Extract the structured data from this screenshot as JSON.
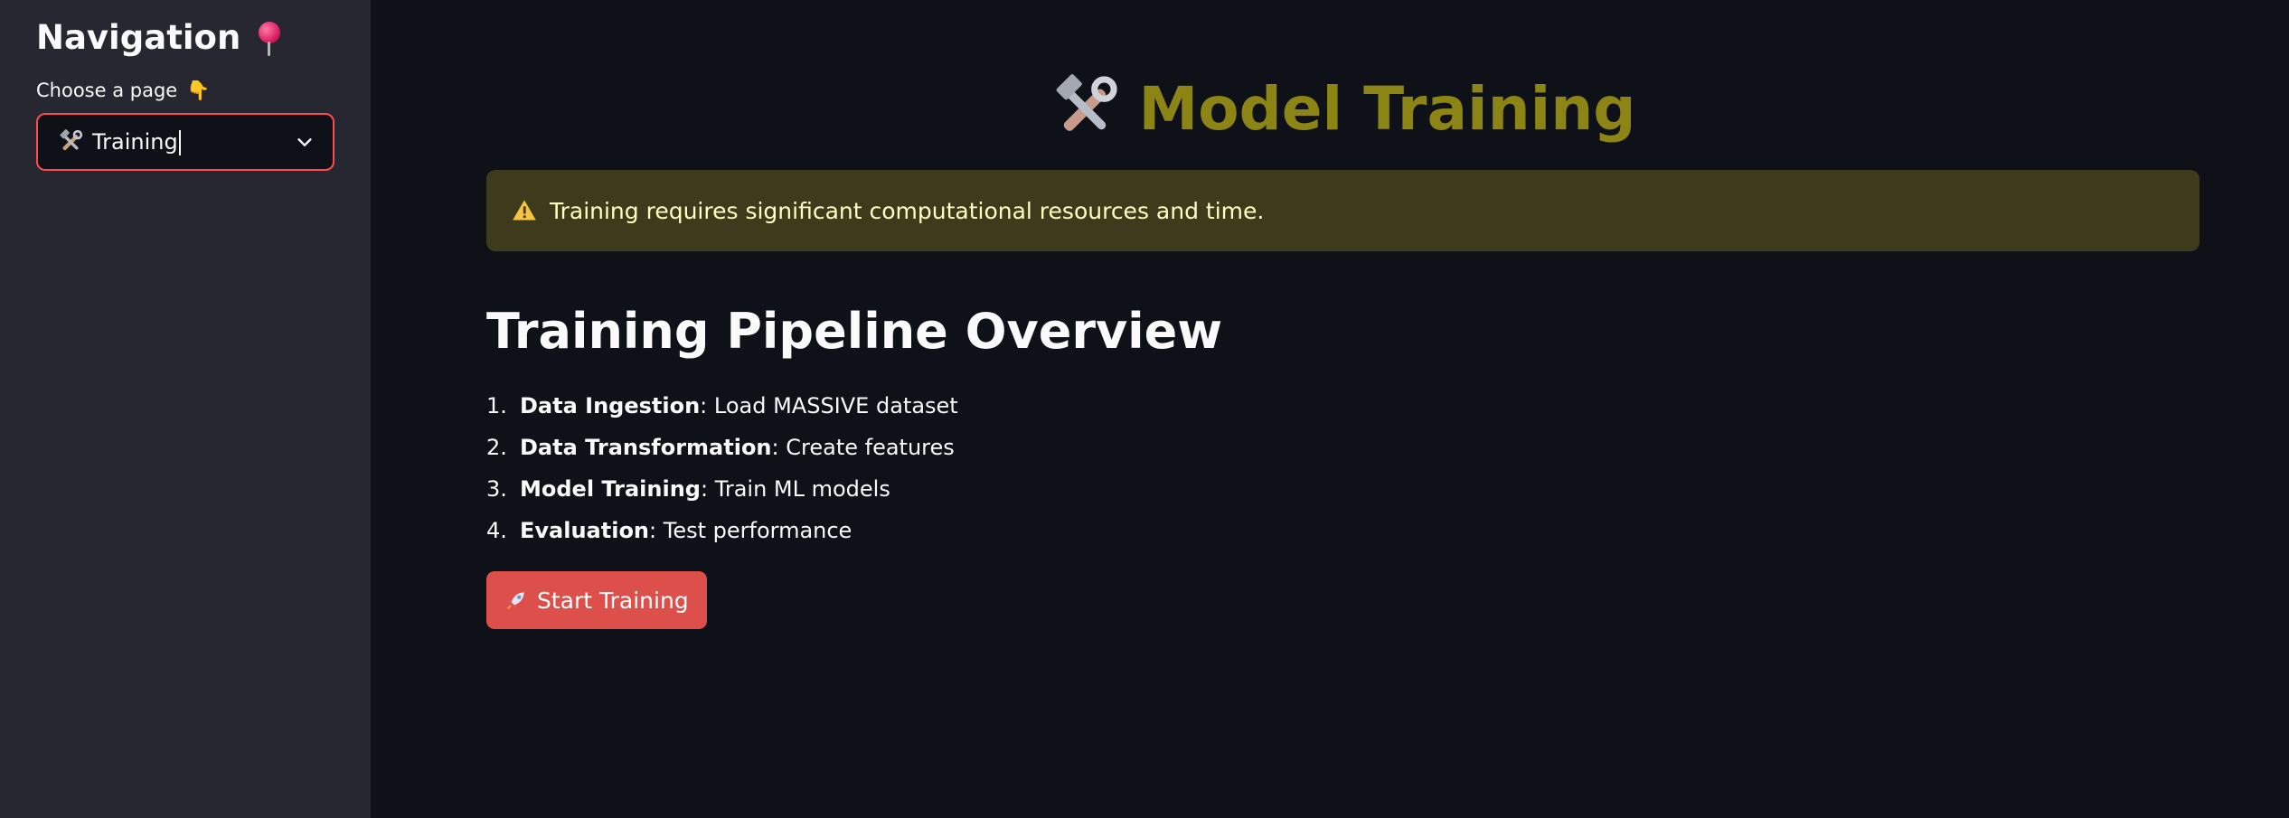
{
  "sidebar": {
    "title": "Navigation",
    "title_icon": "pushpin-icon",
    "select_label": "Choose a page",
    "select_label_icon": "pointing-down-hand-icon",
    "select_value": "Training",
    "select_icon": "hammer-and-wrench-icon"
  },
  "main": {
    "title": "Model Training",
    "title_icon": "hammer-and-wrench-icon",
    "title_color": "#8c8415",
    "warning": {
      "icon": "warning-icon",
      "text": "Training requires significant computational resources and time."
    },
    "section_title": "Training Pipeline Overview",
    "pipeline": [
      {
        "num": "1.",
        "label": "Data Ingestion",
        "desc": ": Load MASSIVE dataset"
      },
      {
        "num": "2.",
        "label": "Data Transformation",
        "desc": ": Create features"
      },
      {
        "num": "3.",
        "label": "Model Training",
        "desc": ": Train ML models"
      },
      {
        "num": "4.",
        "label": "Evaluation",
        "desc": ": Test performance"
      }
    ],
    "start_button": {
      "label": "Start Training",
      "icon": "rocket-icon",
      "color": "#dd4f4a"
    }
  }
}
